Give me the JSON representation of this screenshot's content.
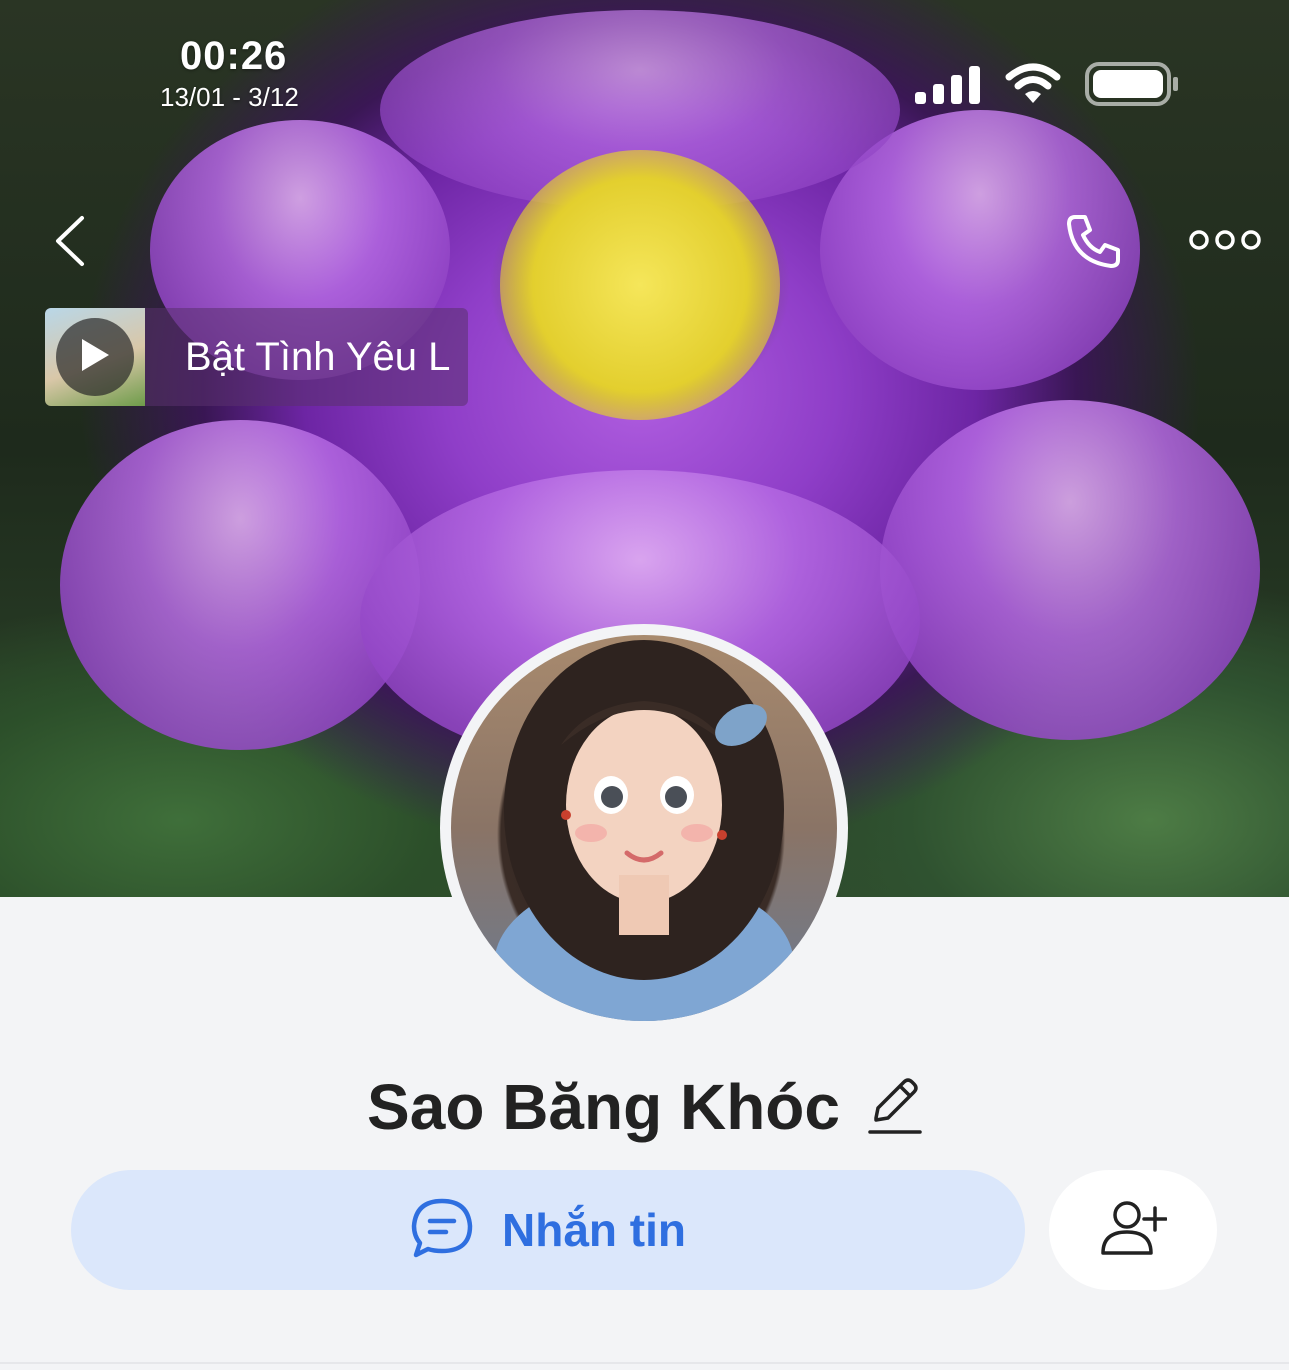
{
  "status_bar": {
    "time": "00:26",
    "date_range": "13/01 - 3/12",
    "signal_icon": "cellular-signal-icon",
    "wifi_icon": "wifi-icon",
    "battery_icon": "battery-icon"
  },
  "header": {
    "back_icon": "chevron-left-icon",
    "call_icon": "phone-icon",
    "more_icon": "more-dots-icon"
  },
  "music": {
    "title": "Bật Tình Yêu L",
    "play_icon": "play-icon"
  },
  "profile": {
    "name": "Sao Băng Khóc",
    "edit_icon": "pencil-icon"
  },
  "actions": {
    "message_label": "Nhắn tin",
    "message_icon": "chat-bubble-icon",
    "add_friend_icon": "add-friend-icon"
  },
  "colors": {
    "accent": "#2f6fe0",
    "message_button_bg": "#dbe7fb",
    "page_bg": "#f3f4f6"
  }
}
